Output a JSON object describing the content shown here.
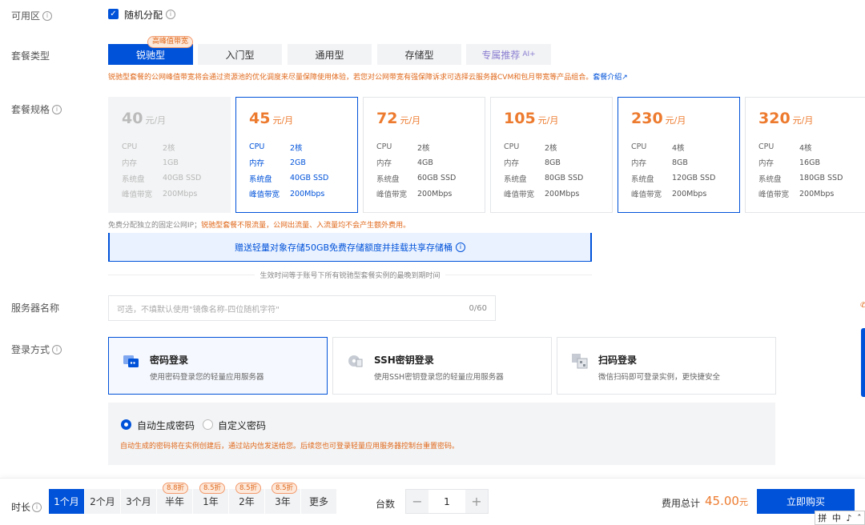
{
  "availability": {
    "label": "可用区",
    "checkbox_label": "随机分配",
    "checked": true
  },
  "plan_type": {
    "label": "套餐类型",
    "badge": "高峰值带宽",
    "tabs": [
      {
        "label": "锐驰型",
        "active": true
      },
      {
        "label": "入门型"
      },
      {
        "label": "通用型"
      },
      {
        "label": "存储型"
      },
      {
        "label": "专属推荐",
        "suffix": "AI+"
      }
    ],
    "note": "锐驰型套餐的公网峰值带宽将会通过资源池的优化调度来尽量保障使用体验，若您对公网带宽有强保障诉求可选择云服务器CVM和包月带宽等产品组合。",
    "note_link": "套餐介绍"
  },
  "plan_spec": {
    "label": "套餐规格",
    "keys": {
      "cpu": "CPU",
      "mem": "内存",
      "disk": "系统盘",
      "bw": "峰值带宽"
    },
    "unit": "元/月",
    "cards": [
      {
        "price": "40",
        "cpu": "2核",
        "mem": "1GB",
        "disk": "40GB SSD",
        "bw": "200Mbps",
        "state": "disabled"
      },
      {
        "price": "45",
        "cpu": "2核",
        "mem": "2GB",
        "disk": "40GB SSD",
        "bw": "200Mbps",
        "state": "selected"
      },
      {
        "price": "72",
        "cpu": "2核",
        "mem": "4GB",
        "disk": "60GB SSD",
        "bw": "200Mbps",
        "state": "normal"
      },
      {
        "price": "105",
        "cpu": "2核",
        "mem": "8GB",
        "disk": "80GB SSD",
        "bw": "200Mbps",
        "state": "normal"
      },
      {
        "price": "230",
        "cpu": "4核",
        "mem": "8GB",
        "disk": "120GB SSD",
        "bw": "200Mbps",
        "state": "highlight"
      },
      {
        "price": "320",
        "cpu": "4核",
        "mem": "16GB",
        "disk": "180GB SSD",
        "bw": "200Mbps",
        "state": "normal"
      }
    ],
    "free_note": "免费分配独立的固定公网IP；",
    "free_note_orange": "锐驰型套餐不限流量，公网出流量、入流量均不会产生额外费用。",
    "banner": "赠送轻量对象存储50GB免费存储额度并挂载共享存储桶",
    "validity": "生效时间等于账号下所有锐驰型套餐实例的最晚到期时间"
  },
  "server_name": {
    "label": "服务器名称",
    "placeholder": "可选，不填默认使用\"镜像名称-四位随机字符\"",
    "counter": "0/60"
  },
  "login": {
    "label": "登录方式",
    "methods": [
      {
        "title": "密码登录",
        "desc": "使用密码登录您的轻量应用服务器",
        "selected": true
      },
      {
        "title": "SSH密钥登录",
        "desc": "使用SSH密钥登录您的轻量应用服务器"
      },
      {
        "title": "扫码登录",
        "desc": "微信扫码即可登录实例，更快捷安全"
      }
    ],
    "options": [
      "自动生成密码",
      "自定义密码"
    ],
    "warning": "自动生成的密码将在实例创建后，通过站内信发送给您。后续您也可登录轻量应用服务器控制台重置密码。"
  },
  "bottom": {
    "duration_label": "时长",
    "durations": [
      {
        "label": "1个月",
        "active": true
      },
      {
        "label": "2个月"
      },
      {
        "label": "3个月"
      },
      {
        "label": "半年",
        "discount": "8.8折"
      },
      {
        "label": "1年",
        "discount": "8.5折"
      },
      {
        "label": "2年",
        "discount": "8.5折"
      },
      {
        "label": "3年",
        "discount": "8.5折"
      },
      {
        "label": "更多"
      }
    ],
    "qty_label": "台数",
    "qty": "1",
    "minus": "−",
    "plus": "+",
    "cost_label": "费用总计",
    "cost": "45.00",
    "cost_unit": "元",
    "buy": "立即购买"
  },
  "ime": {
    "items": [
      "拼",
      "中",
      "♪",
      "ˆ"
    ]
  },
  "colors": {
    "primary": "#0052d9",
    "orange": "#ed7b2f"
  }
}
